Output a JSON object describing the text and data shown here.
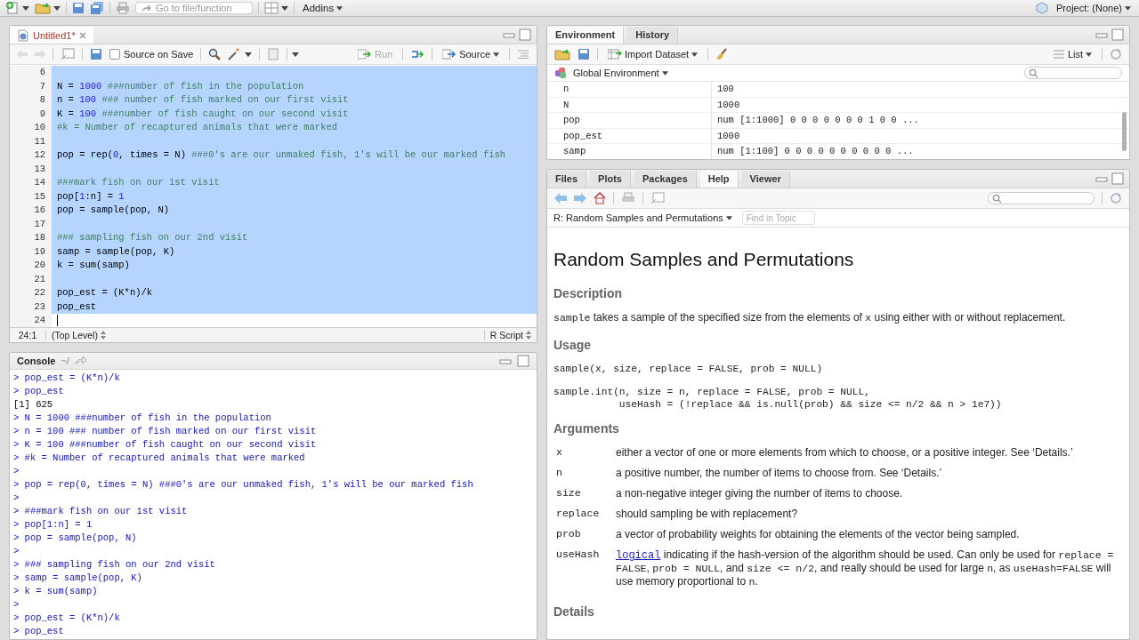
{
  "toolbar": {
    "goto_placeholder": "Go to file/function",
    "addins": "Addins",
    "project": "Project: (None)"
  },
  "editor": {
    "tabs": [
      {
        "label": "Untitled1*",
        "selected": true
      }
    ],
    "source_on_save": {
      "label": "Source on Save",
      "checked": false
    },
    "run": "Run",
    "source": "Source",
    "lines": [
      {
        "number": "6",
        "selected": true
      },
      {
        "number": "7",
        "selected": true,
        "tokens": [
          {
            "kind": "code",
            "text": "N = "
          },
          {
            "kind": "num",
            "text": "1000"
          },
          {
            "kind": "comment",
            "text": " ###number of fish in the population"
          }
        ]
      },
      {
        "number": "8",
        "selected": true,
        "tokens": [
          {
            "kind": "code",
            "text": "n = "
          },
          {
            "kind": "num",
            "text": "100"
          },
          {
            "kind": "comment",
            "text": " ### number of fish marked on our first visit"
          }
        ]
      },
      {
        "number": "9",
        "selected": true,
        "tokens": [
          {
            "kind": "code",
            "text": "K = "
          },
          {
            "kind": "num",
            "text": "100"
          },
          {
            "kind": "comment",
            "text": " ###number of fish caught on our second visit"
          }
        ]
      },
      {
        "number": "10",
        "selected": true,
        "tokens": [
          {
            "kind": "comment",
            "text": "#k = Number of recaptured animals that were marked"
          }
        ]
      },
      {
        "number": "11",
        "selected": true
      },
      {
        "number": "12",
        "selected": true,
        "tokens": [
          {
            "kind": "code",
            "text": "pop = rep("
          },
          {
            "kind": "num",
            "text": "0"
          },
          {
            "kind": "code",
            "text": ", times = N) "
          },
          {
            "kind": "comment",
            "text": "###0's are our unmaked fish, 1's will be our marked fish"
          }
        ]
      },
      {
        "number": "13",
        "selected": true
      },
      {
        "number": "14",
        "selected": true,
        "tokens": [
          {
            "kind": "comment",
            "text": "###mark fish on our 1st visit"
          }
        ]
      },
      {
        "number": "15",
        "selected": true,
        "tokens": [
          {
            "kind": "code",
            "text": "pop["
          },
          {
            "kind": "num",
            "text": "1"
          },
          {
            "kind": "code",
            "text": ":n] = "
          },
          {
            "kind": "num",
            "text": "1"
          }
        ]
      },
      {
        "number": "16",
        "selected": true,
        "tokens": [
          {
            "kind": "code",
            "text": "pop = sample(pop, N)"
          }
        ]
      },
      {
        "number": "17",
        "selected": true
      },
      {
        "number": "18",
        "selected": true,
        "tokens": [
          {
            "kind": "comment",
            "text": "### sampling fish on our 2nd visit"
          }
        ]
      },
      {
        "number": "19",
        "selected": true,
        "tokens": [
          {
            "kind": "code",
            "text": "samp = sample(pop, K)"
          }
        ]
      },
      {
        "number": "20",
        "selected": true,
        "tokens": [
          {
            "kind": "code",
            "text": "k = sum(samp)"
          }
        ]
      },
      {
        "number": "21",
        "selected": true
      },
      {
        "number": "22",
        "selected": true,
        "tokens": [
          {
            "kind": "code",
            "text": "pop_est = (K*n)/k"
          }
        ]
      },
      {
        "number": "23",
        "selected": true,
        "tokens": [
          {
            "kind": "code",
            "text": "pop_est"
          }
        ]
      },
      {
        "number": "24",
        "selected": false,
        "cursor": true
      }
    ],
    "position": "24:1",
    "scope": "(Top Level)",
    "file_type": "R Script"
  },
  "console": {
    "title": "Console",
    "path": "~/",
    "lines": [
      {
        "kind": "input",
        "text": "> pop_est = (K*n)/k"
      },
      {
        "kind": "input",
        "text": "> pop_est"
      },
      {
        "kind": "output",
        "text": "[1] 625"
      },
      {
        "kind": "input",
        "text": "> N = 1000 ###number of fish in the population"
      },
      {
        "kind": "input",
        "text": "> n = 100 ### number of fish marked on our first visit"
      },
      {
        "kind": "input",
        "text": "> K = 100 ###number of fish caught on our second visit"
      },
      {
        "kind": "input",
        "text": "> #k = Number of recaptured animals that were marked"
      },
      {
        "kind": "input",
        "text": ">"
      },
      {
        "kind": "input",
        "text": "> pop = rep(0, times = N) ###0's are our unmaked fish, 1's will be our marked fish"
      },
      {
        "kind": "input",
        "text": ">"
      },
      {
        "kind": "input",
        "text": "> ###mark fish on our 1st visit"
      },
      {
        "kind": "input",
        "text": "> pop[1:n] = 1"
      },
      {
        "kind": "input",
        "text": "> pop = sample(pop, N)"
      },
      {
        "kind": "input",
        "text": ">"
      },
      {
        "kind": "input",
        "text": "> ### sampling fish on our 2nd visit"
      },
      {
        "kind": "input",
        "text": "> samp = sample(pop, K)"
      },
      {
        "kind": "input",
        "text": "> k = sum(samp)"
      },
      {
        "kind": "input",
        "text": ">"
      },
      {
        "kind": "input",
        "text": "> pop_est = (K*n)/k"
      },
      {
        "kind": "input",
        "text": "> pop_est"
      }
    ]
  },
  "environment": {
    "tabs": [
      {
        "label": "Environment",
        "selected": true
      },
      {
        "label": "History",
        "selected": false
      }
    ],
    "import": "Import Dataset",
    "view": "List",
    "scope": "Global Environment",
    "rows": [
      {
        "name": "n",
        "value": "100"
      },
      {
        "name": "N",
        "value": "1000"
      },
      {
        "name": "pop",
        "value": "num [1:1000] 0 0 0 0 0 0 0 1 0 0 ..."
      },
      {
        "name": "pop_est",
        "value": "1000"
      },
      {
        "name": "samp",
        "value": "num [1:100] 0 0 0 0 0 0 0 0 0 0 ..."
      }
    ]
  },
  "help": {
    "tabs": [
      {
        "label": "Files",
        "selected": false
      },
      {
        "label": "Plots",
        "selected": false
      },
      {
        "label": "Packages",
        "selected": false
      },
      {
        "label": "Help",
        "selected": true
      },
      {
        "label": "Viewer",
        "selected": false
      }
    ],
    "topic": "R: Random Samples and Permutations",
    "find_placeholder": "Find in Topic",
    "title": "Random Samples and Permutations",
    "sections": [
      {
        "heading": "Description",
        "kind": "paragraph",
        "segments": [
          {
            "kind": "code",
            "text": "sample"
          },
          {
            "kind": "text",
            "text": " takes a sample of the specified size from the elements of "
          },
          {
            "kind": "code",
            "text": "x"
          },
          {
            "kind": "text",
            "text": " using either with or without replacement."
          }
        ]
      },
      {
        "heading": "Usage",
        "kind": "code",
        "blocks": [
          "sample(x, size, replace = FALSE, prob = NULL)",
          "sample.int(n, size = n, replace = FALSE, prob = NULL,\n           useHash = (!replace && is.null(prob) && size <= n/2 && n > 1e7))"
        ]
      },
      {
        "heading": "Arguments",
        "kind": "arguments",
        "args": [
          {
            "name": "x",
            "segments": [
              {
                "kind": "text",
                "text": "either a vector of one or more elements from which to choose, or a positive integer. See ‘Details.’"
              }
            ]
          },
          {
            "name": "n",
            "segments": [
              {
                "kind": "text",
                "text": "a positive number, the number of items to choose from. See ‘Details.’"
              }
            ]
          },
          {
            "name": "size",
            "segments": [
              {
                "kind": "text",
                "text": "a non-negative integer giving the number of items to choose."
              }
            ]
          },
          {
            "name": "replace",
            "segments": [
              {
                "kind": "text",
                "text": "should sampling be with replacement?"
              }
            ]
          },
          {
            "name": "prob",
            "segments": [
              {
                "kind": "text",
                "text": "a vector of probability weights for obtaining the elements of the vector being sampled."
              }
            ]
          },
          {
            "name": "useHash",
            "segments": [
              {
                "kind": "link",
                "text": "logical"
              },
              {
                "kind": "text",
                "text": " indicating if the hash-version of the algorithm should be used. Can only be used for "
              },
              {
                "kind": "code",
                "text": "replace = FALSE"
              },
              {
                "kind": "text",
                "text": ", "
              },
              {
                "kind": "code",
                "text": "prob = NULL"
              },
              {
                "kind": "text",
                "text": ", and "
              },
              {
                "kind": "code",
                "text": "size <= n/2"
              },
              {
                "kind": "text",
                "text": ", and really should be used for large "
              },
              {
                "kind": "code",
                "text": "n"
              },
              {
                "kind": "text",
                "text": ", as "
              },
              {
                "kind": "code",
                "text": "useHash=FALSE"
              },
              {
                "kind": "text",
                "text": " will use memory proportional to "
              },
              {
                "kind": "code",
                "text": "n"
              },
              {
                "kind": "text",
                "text": "."
              }
            ]
          }
        ]
      },
      {
        "heading": "Details",
        "kind": "heading"
      }
    ]
  }
}
